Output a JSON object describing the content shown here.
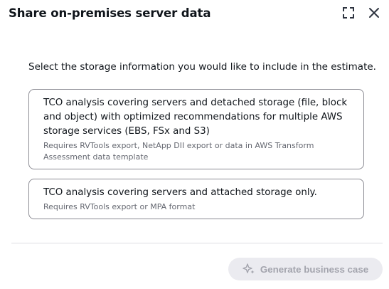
{
  "modal": {
    "title": "Share on-premises server data",
    "prompt": "Select the storage information you would like to include in the estimate.",
    "options": [
      {
        "label": "TCO analysis covering servers and detached storage (file, block and object) with optimized recommendations for multiple AWS storage services (EBS, FSx and S3)",
        "hint": "Requires RVTools export, NetApp DII export or data in AWS Transform Assessment data template"
      },
      {
        "label": "TCO analysis covering servers and attached storage only.",
        "hint": "Requires RVTools export or MPA format"
      }
    ],
    "generate_button": {
      "label": "Generate business case",
      "icon": "sparkle-icon",
      "disabled": true
    },
    "header_icons": [
      "expand-icon",
      "close-icon"
    ]
  },
  "colors": {
    "border": "#8c8c94",
    "hint_text": "#656871",
    "disabled_bg": "#ebebf0",
    "disabled_text": "#a3a4ad"
  }
}
